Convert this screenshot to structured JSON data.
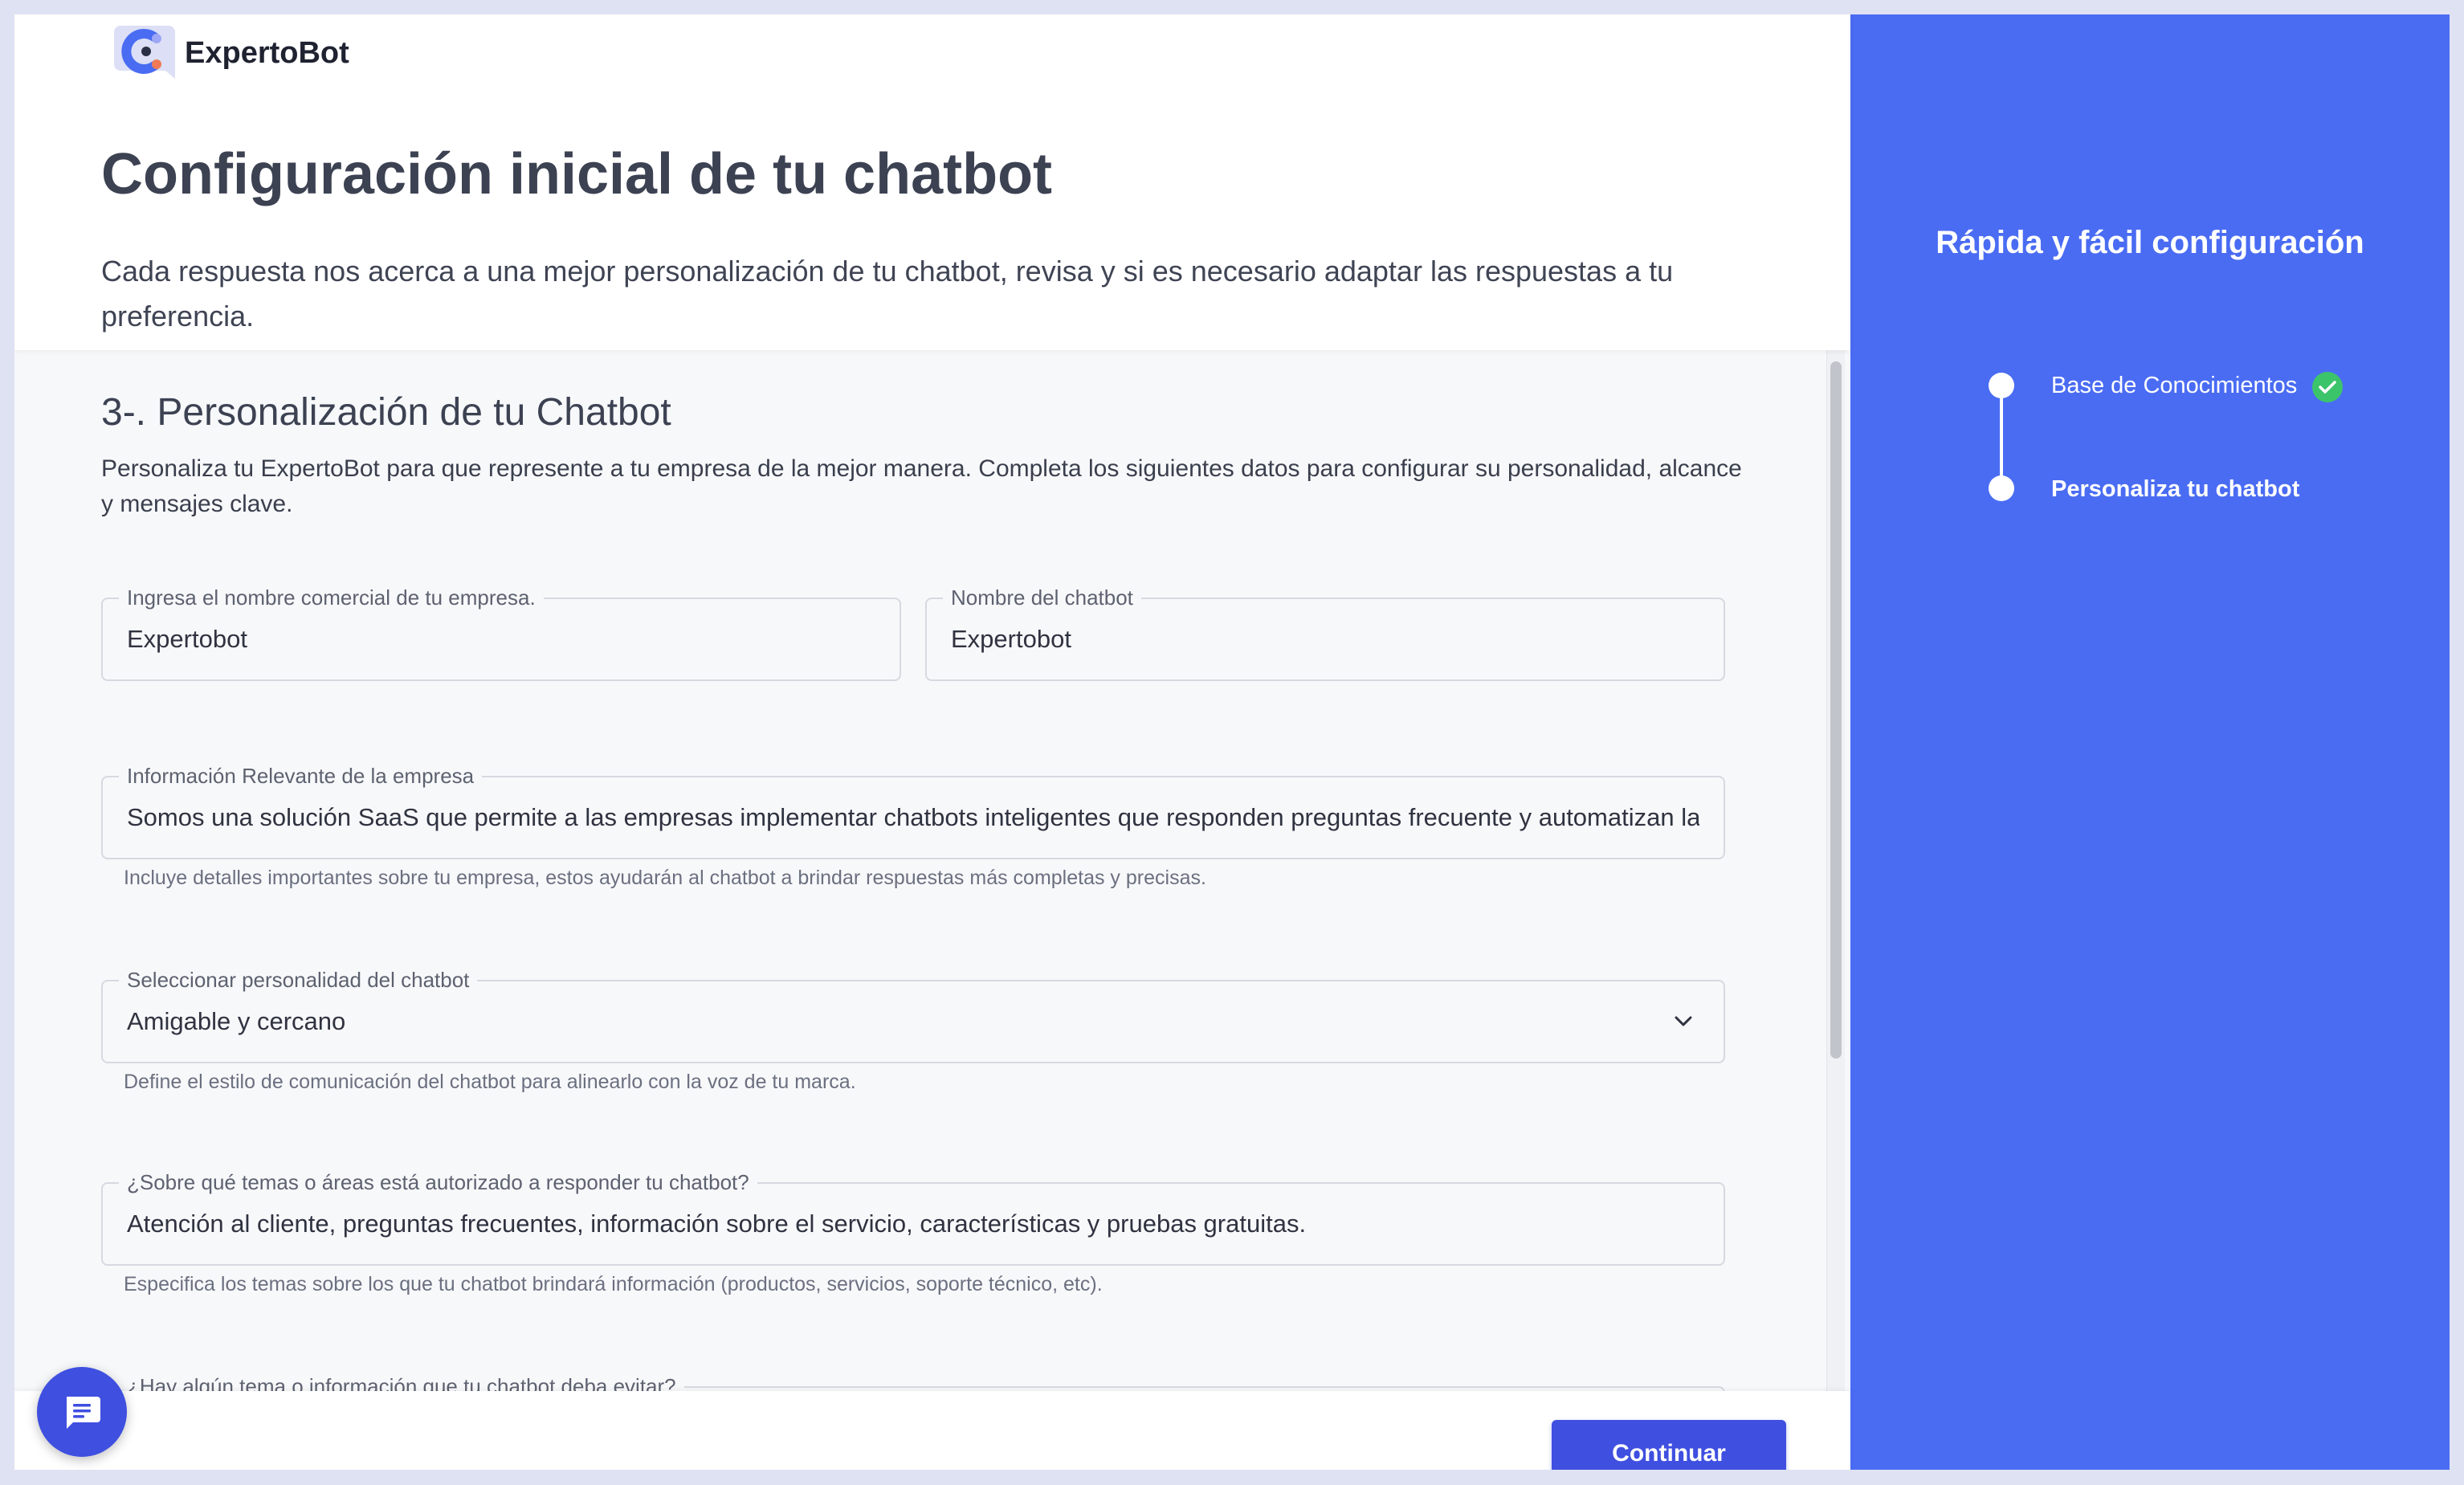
{
  "brand": {
    "name": "ExpertoBot"
  },
  "header": {
    "title": "Configuración inicial de tu chatbot",
    "description": "Cada respuesta nos acerca a una mejor personalización de tu chatbot, revisa y si es necesario adaptar las respuestas a tu preferencia."
  },
  "section": {
    "title": "3-. Personalización de tu Chatbot",
    "description": "Personaliza tu ExpertoBot para que represente a tu empresa de la mejor manera. Completa los siguientes datos para configurar su personalidad, alcance y mensajes clave."
  },
  "fields": {
    "company_name": {
      "label": "Ingresa el nombre comercial de tu empresa.",
      "value": "Expertobot"
    },
    "chatbot_name": {
      "label": "Nombre del chatbot",
      "value": "Expertobot"
    },
    "company_info": {
      "label": "Información Relevante de la empresa",
      "value": "Somos una solución SaaS que permite a las empresas implementar chatbots inteligentes que responden preguntas frecuente y automatizan la atención al cliente",
      "helper": "Incluye detalles importantes sobre tu empresa, estos ayudarán al chatbot a brindar respuestas más completas y precisas."
    },
    "personality": {
      "label": "Seleccionar personalidad del chatbot",
      "value": "Amigable y cercano",
      "helper": "Define el estilo de comunicación del chatbot para alinearlo con la voz de tu marca."
    },
    "topics": {
      "label": "¿Sobre qué temas o áreas está autorizado a responder tu chatbot?",
      "value": "Atención al cliente, preguntas frecuentes, información sobre el servicio, características y pruebas gratuitas.",
      "helper": "Especifica los temas sobre los que tu chatbot brindará información (productos, servicios, soporte técnico, etc)."
    },
    "avoid_topics": {
      "label": "¿Hay algún tema o información que tu chatbot deba evitar?"
    }
  },
  "footer": {
    "continue_label": "Continuar"
  },
  "sidebar": {
    "title": "Rápida y fácil configuración",
    "steps": [
      {
        "label": "Base de Conocimientos",
        "completed": true
      },
      {
        "label": "Personaliza tu chatbot",
        "active": true
      }
    ]
  },
  "colors": {
    "accent": "#3f4fe0",
    "sidebar_bg": "#4a6cf3",
    "success": "#3cc46b"
  },
  "icons": [
    "logo-icon",
    "chevron-down-icon",
    "check-icon",
    "chat-icon"
  ]
}
